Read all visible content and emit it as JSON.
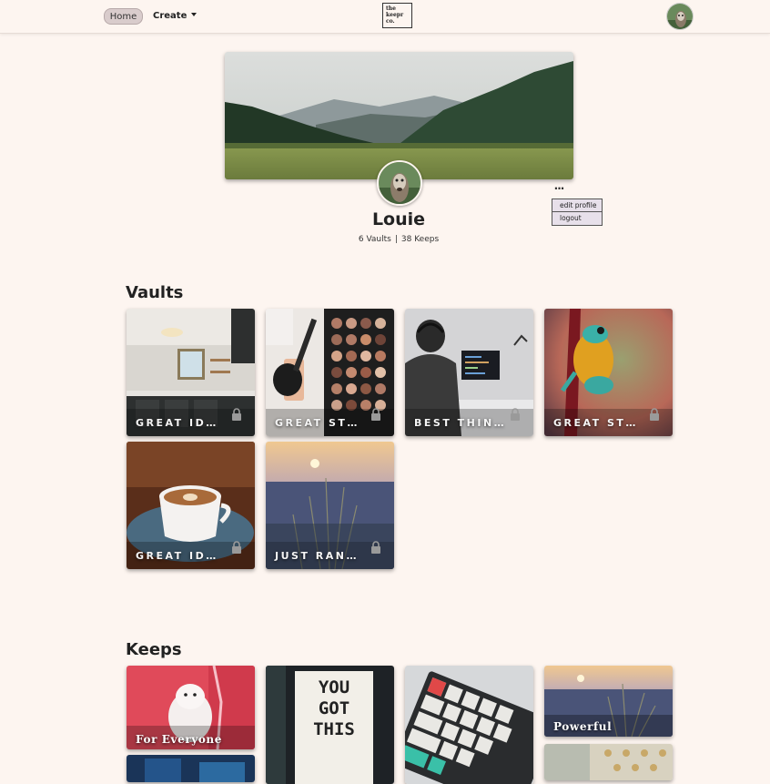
{
  "navbar": {
    "home_label": "Home",
    "create_label": "Create",
    "logo_lines": [
      "the",
      "keepr",
      "co."
    ]
  },
  "profile": {
    "name": "Louie",
    "vaults_stat": "6 Vaults",
    "keeps_stat": "38 Keeps",
    "separator": "|",
    "more_glyph": "...",
    "menu": {
      "edit_label": "edit profile",
      "logout_label": "logout"
    }
  },
  "vaults": {
    "title": "Vaults",
    "items": [
      {
        "label": "GREAT ID…",
        "image": "kitchen-photo",
        "locked": true
      },
      {
        "label": "GREAT ST…",
        "image": "makeup-palette-photo",
        "locked": true
      },
      {
        "label": "BEST THIN…",
        "image": "programmer-desk-photo",
        "locked": true
      },
      {
        "label": "GREAT ST…",
        "image": "frog-photo",
        "locked": true
      },
      {
        "label": "GREAT ID…",
        "image": "coffee-cup-photo",
        "locked": true
      },
      {
        "label": "JUST RAN…",
        "image": "sunset-field-photo",
        "locked": true
      }
    ]
  },
  "keeps": {
    "title": "Keeps",
    "items": [
      {
        "label": "For Everyone",
        "image": "white-dog-photo"
      },
      {
        "label": "",
        "image": "lightbox-sign-photo"
      },
      {
        "label": "",
        "image": "keyboard-photo"
      },
      {
        "label": "Powerful",
        "image": "sunset-field-photo"
      },
      {
        "label": "",
        "image": "blue-room-photo"
      },
      {
        "label": "",
        "image": "wallpaper-photo"
      }
    ]
  },
  "sign_text": [
    "YOU",
    "GOT",
    "THIS"
  ],
  "colors": {
    "background": "#fdf5f0",
    "home_pill": "#d9cccc",
    "menu_bg": "#e7e0ea"
  }
}
